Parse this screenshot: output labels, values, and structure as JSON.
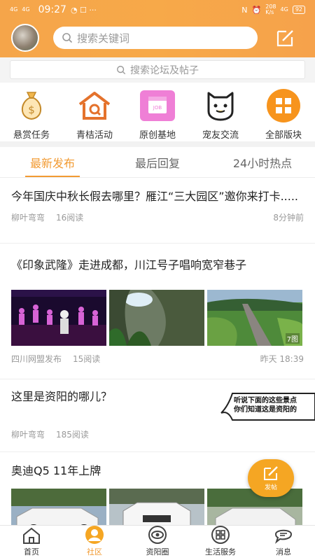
{
  "status_bar": {
    "time": "09:27",
    "left_signal_1": "4G",
    "left_signal_2": "4G",
    "speed": "208",
    "speed_unit": "K/s",
    "net": "4G",
    "battery": "92"
  },
  "header": {
    "search_placeholder": "搜索关键词"
  },
  "forum_search": {
    "placeholder": "搜索论坛及帖子"
  },
  "categories": [
    {
      "label": "悬赏任务",
      "icon": "money-bag-icon"
    },
    {
      "label": "青桔活动",
      "icon": "house-icon"
    },
    {
      "label": "原创基地",
      "icon": "job-calendar-icon"
    },
    {
      "label": "宠友交流",
      "icon": "pet-icon"
    },
    {
      "label": "全部版块",
      "icon": "grid-icon"
    }
  ],
  "tabs": [
    {
      "label": "最新发布",
      "active": true
    },
    {
      "label": "最后回复",
      "active": false
    },
    {
      "label": "24小时热点",
      "active": false
    }
  ],
  "posts": [
    {
      "title": "今年国庆中秋长假去哪里？雁江“三大园区”邀你来打卡.....",
      "author": "柳叶弯弯",
      "reads": "16阅读",
      "time": "8分钟前"
    },
    {
      "title": "《印象武隆》走进成都，川江号子唱响宽窄巷子",
      "author": "四川网盟发布",
      "reads": "15阅读",
      "time": "昨天 18:39",
      "image_count": "7图"
    },
    {
      "title": "这里是资阳的哪儿？",
      "author": "柳叶弯弯",
      "reads": "185阅读",
      "bubble_text_1": "听说下面的这些景点",
      "bubble_text_2": "你们知道这是资阳的"
    },
    {
      "title": "奥迪Q5 11年上牌"
    }
  ],
  "fab": {
    "label": "发帖"
  },
  "bottom_nav": [
    {
      "label": "首页",
      "active": false
    },
    {
      "label": "社区",
      "active": true
    },
    {
      "label": "资阳圈",
      "active": false
    },
    {
      "label": "生活服务",
      "active": false
    },
    {
      "label": "消息",
      "active": false
    }
  ],
  "colors": {
    "accent": "#f29b33",
    "header": "#f6a64a"
  }
}
